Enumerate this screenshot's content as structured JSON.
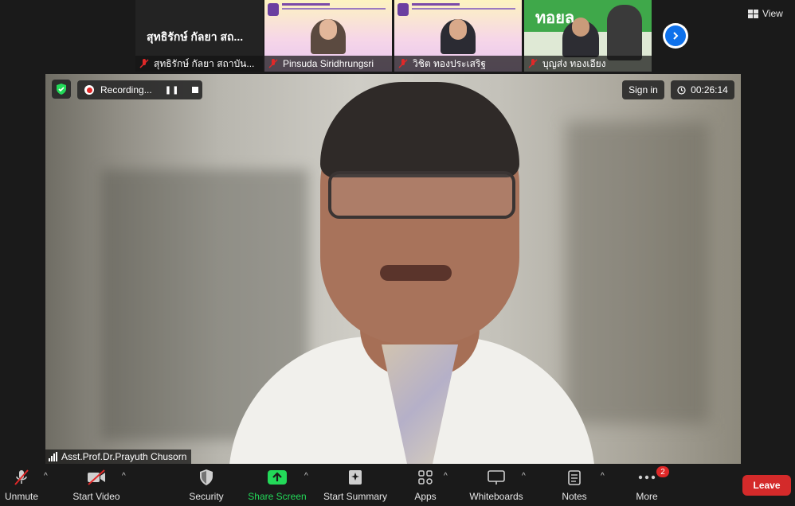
{
  "gallery": {
    "tiles": [
      {
        "name": "สุทธิรักษ์ กัลยา สถาบัน...",
        "big_name": "สุทธิรักษ์ กัลยา สถ..."
      },
      {
        "name": "Pinsuda Siridhrungsri"
      },
      {
        "name": "วิชิต ทองประเสริฐ"
      },
      {
        "name": "บุญส่ง ทองเอียง",
        "banner_text": "ทอยล"
      }
    ],
    "view_label": "View"
  },
  "meeting": {
    "recording_label": "Recording...",
    "pause_symbol": "❚❚",
    "sign_in_label": "Sign in",
    "timer": "00:26:14",
    "active_speaker": "Asst.Prof.Dr.Prayuth Chusorn"
  },
  "toolbar": {
    "unmute": "Unmute",
    "start_video": "Start Video",
    "security": "Security",
    "share_screen": "Share Screen",
    "start_summary": "Start Summary",
    "apps": "Apps",
    "whiteboards": "Whiteboards",
    "notes": "Notes",
    "more": "More",
    "more_badge": "2",
    "leave": "Leave",
    "caret": "^"
  },
  "colors": {
    "share_green": "#23d959",
    "leave_red": "#d42a2a",
    "accent_blue": "#0e71eb",
    "secure_green": "#23d959"
  }
}
